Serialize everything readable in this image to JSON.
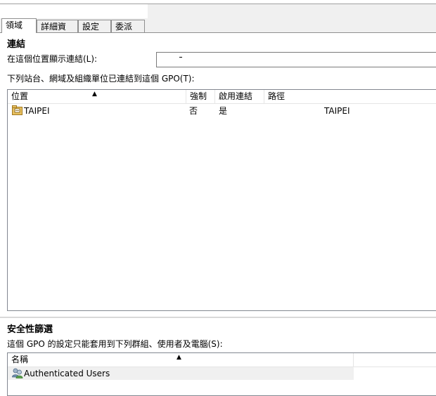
{
  "tabs": [
    {
      "label": "領域",
      "active": true
    },
    {
      "label": "詳細資料",
      "active": false
    },
    {
      "label": "設定",
      "active": false
    },
    {
      "label": "委派",
      "active": false
    }
  ],
  "links": {
    "heading": "連結",
    "show_links_label": "在這個位置顯示連結(L):",
    "location_value": "",
    "linked_label": "下列站台、網域及組織單位已連結到這個 GPO(T):",
    "columns": [
      "位置",
      "強制",
      "啟用連結",
      "路徑"
    ],
    "rows": [
      {
        "location": "TAIPEI",
        "enforced": "否",
        "link_enabled": "是",
        "path": "TAIPEI"
      }
    ]
  },
  "security": {
    "heading": "安全性篩選",
    "description": "這個 GPO 的設定只能套用到下列群組、使用者及電腦(S):",
    "columns": [
      "名稱"
    ],
    "rows": [
      {
        "name": "Authenticated Users"
      }
    ]
  },
  "icons": {
    "sort": "sort-ascending-icon",
    "domain": "domain-folder-icon",
    "users": "user-group-icon"
  }
}
